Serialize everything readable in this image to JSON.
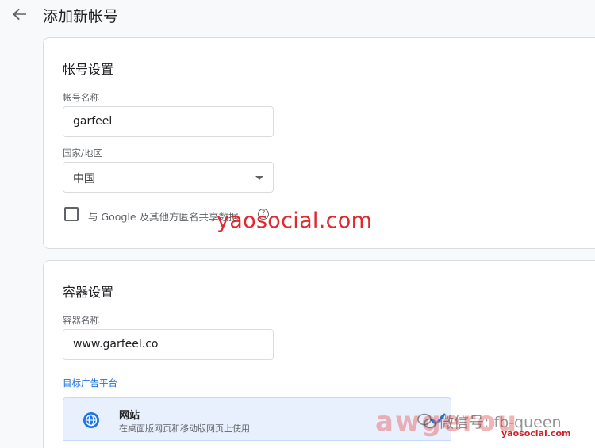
{
  "header": {
    "title": "添加新帐号"
  },
  "account_settings": {
    "title": "帐号设置",
    "account_name_label": "帐号名称",
    "account_name_value": "garfeel",
    "country_label": "国家/地区",
    "country_value": "中国",
    "share_checkbox_label": "与 Google 及其他方匿名共享数据",
    "share_checkbox_checked": false,
    "help_icon": "?"
  },
  "container_settings": {
    "title": "容器设置",
    "container_name_label": "容器名称",
    "container_name_value": "www.garfeel.co",
    "target_platform_label": "目标广告平台",
    "platforms": [
      {
        "name": "网站",
        "description": "在桌面版网页和移动版网页上使用",
        "icon": "globe-icon",
        "selected": true
      }
    ]
  },
  "watermarks": {
    "main": "yaosocial.com",
    "awg": "awgerou",
    "wechat": "微信号: fb-queen",
    "small": "yaosocial.com"
  },
  "colors": {
    "accent": "#1a73e8",
    "watermark_red": "#e0282e",
    "selected_bg": "#e8f0fe"
  }
}
